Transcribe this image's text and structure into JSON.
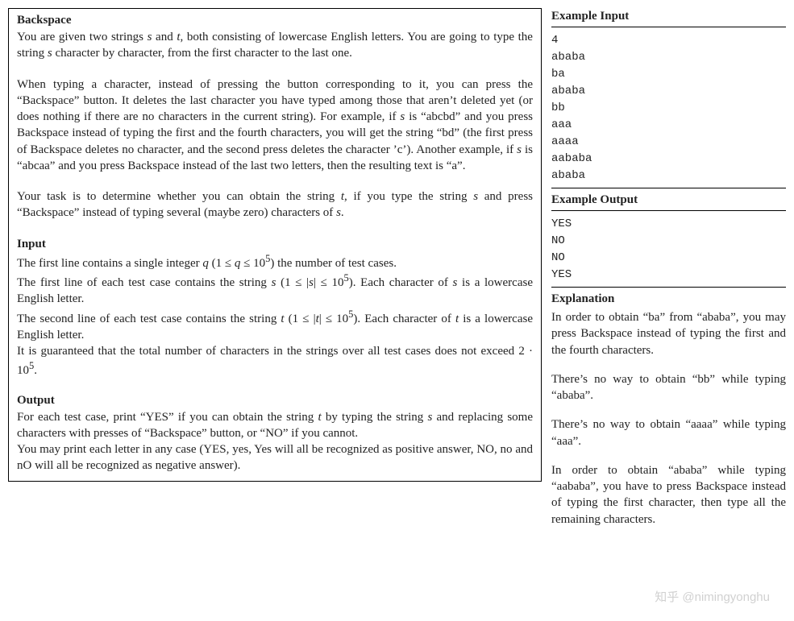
{
  "problem": {
    "title": "Backspace",
    "intro": "You are given two strings s and t, both consisting of lowercase English letters. You are going to type the string s character by character, from the first character to the last one.",
    "desc": "When typing a character, instead of pressing the button corresponding to it, you can press the “Backspace” button. It deletes the last character you have typed among those that aren’t deleted yet (or does nothing if there are no characters in the current string). For example, if s is “abcbd” and you press Backspace instead of typing the first and the fourth characters, you will get the string “bd” (the first press of Backspace deletes no character, and the second press deletes the character ’c’). Another example, if s is “abcaa” and you press Backspace instead of the last two letters, then the resulting text is “a”.",
    "task": "Your task is to determine whether you can obtain the string t, if you type the string s and press “Backspace” instead of typing several (maybe zero) characters of s.",
    "input_heading": "Input",
    "input_lines": {
      "l1_a": "The first line contains a single integer q (1 ≤ q ≤ 10",
      "l1_b": ") the number of test cases.",
      "l2_a": "The first line of each test case contains the string s (1 ≤ |s| ≤ 10",
      "l2_b": "). Each character of s is a lowercase English letter.",
      "l3_a": "The second line of each test case contains the string t (1 ≤ |t| ≤ 10",
      "l3_b": "). Each character of t is a lowercase English letter.",
      "l4_a": "It is guaranteed that the total number of characters in the strings over all test cases does not exceed 2 · 10",
      "l4_b": "."
    },
    "output_heading": "Output",
    "output_p1": "For each test case, print “YES” if you can obtain the string t by typing the string s and replacing some characters with presses of “Backspace” button, or “NO” if you cannot.",
    "output_p2": "You may print each letter in any case (YES, yes, Yes will all be recognized as positive answer, NO, no and nO will all be recognized as negative answer)."
  },
  "example": {
    "input_heading": "Example Input",
    "input_text": "4\nababa\nba\nababa\nbb\naaa\naaaa\naababa\nababa",
    "output_heading": "Example Output",
    "output_text": "YES\nNO\nNO\nYES",
    "explanation_heading": "Explanation",
    "exp_p1": "In order to obtain “ba” from “ababa”, you may press Backspace instead of typing the first and the fourth characters.",
    "exp_p2": "There’s no way to obtain “bb” while typing “ababa”.",
    "exp_p3": "There’s no way to obtain “aaaa” while typing “aaa”.",
    "exp_p4": "In order to obtain “ababa” while typing “aababa”, you have to press Backspace instead of typing the first character, then type all the remaining characters."
  },
  "watermark": "知乎 @nimingyonghu"
}
